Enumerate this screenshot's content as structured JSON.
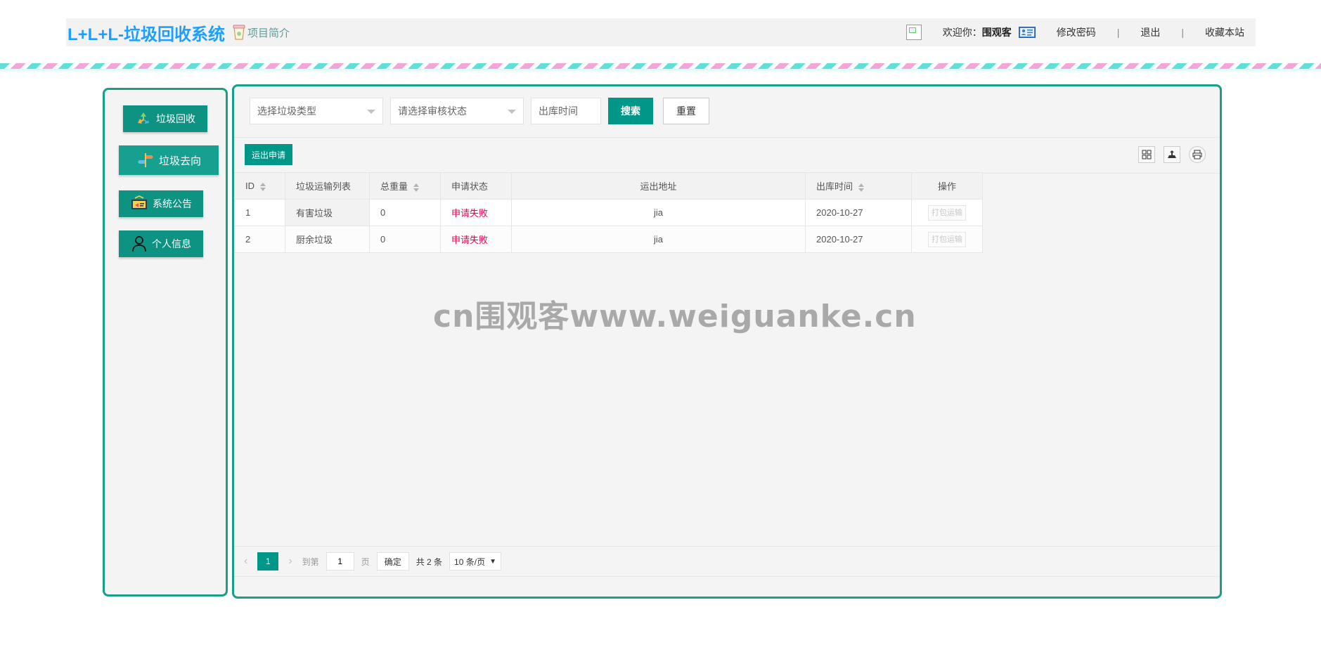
{
  "header": {
    "brand": "L+L+L-垃圾回收系统",
    "intro_link": "项目简介",
    "welcome_label": "欢迎你：",
    "username": "围观客",
    "change_password": "修改密码",
    "separator": "|",
    "logout": "退出",
    "bookmark": "收藏本站"
  },
  "sidebar": {
    "items": [
      {
        "label": "垃圾回收",
        "icon": "recycle-icon"
      },
      {
        "label": "垃圾去向",
        "icon": "signpost-icon"
      },
      {
        "label": "系统公告",
        "icon": "announcement-icon"
      },
      {
        "label": "个人信息",
        "icon": "person-icon"
      }
    ]
  },
  "filters": {
    "type_placeholder": "选择垃圾类型",
    "status_placeholder": "请选择审核状态",
    "date_placeholder": "出库时间",
    "search_label": "搜索",
    "reset_label": "重置"
  },
  "toolbar": {
    "apply_label": "运出申请"
  },
  "table": {
    "columns": [
      "ID",
      "垃圾运输列表",
      "总重量",
      "申请状态",
      "运出地址",
      "出库时间",
      "操作"
    ],
    "rows": [
      {
        "id": "1",
        "list": "有害垃圾",
        "weight": "0",
        "status": "申请失败",
        "address": "jia",
        "date": "2020-10-27",
        "action": "打包运输"
      },
      {
        "id": "2",
        "list": "厨余垃圾",
        "weight": "0",
        "status": "申请失败",
        "address": "jia",
        "date": "2020-10-27",
        "action": "打包运输"
      }
    ]
  },
  "watermark": "cn围观客www.weiguanke.cn",
  "pagination": {
    "prev": "‹",
    "current_page": "1",
    "next": "›",
    "goto_label": "到第",
    "goto_value": "1",
    "page_unit": "页",
    "confirm_label": "确定",
    "total_label": "共 2 条",
    "page_size": "10 条/页"
  },
  "colors": {
    "primary": "#009688",
    "brand_blue": "#1e9fff",
    "fail_red": "#e9004d"
  }
}
